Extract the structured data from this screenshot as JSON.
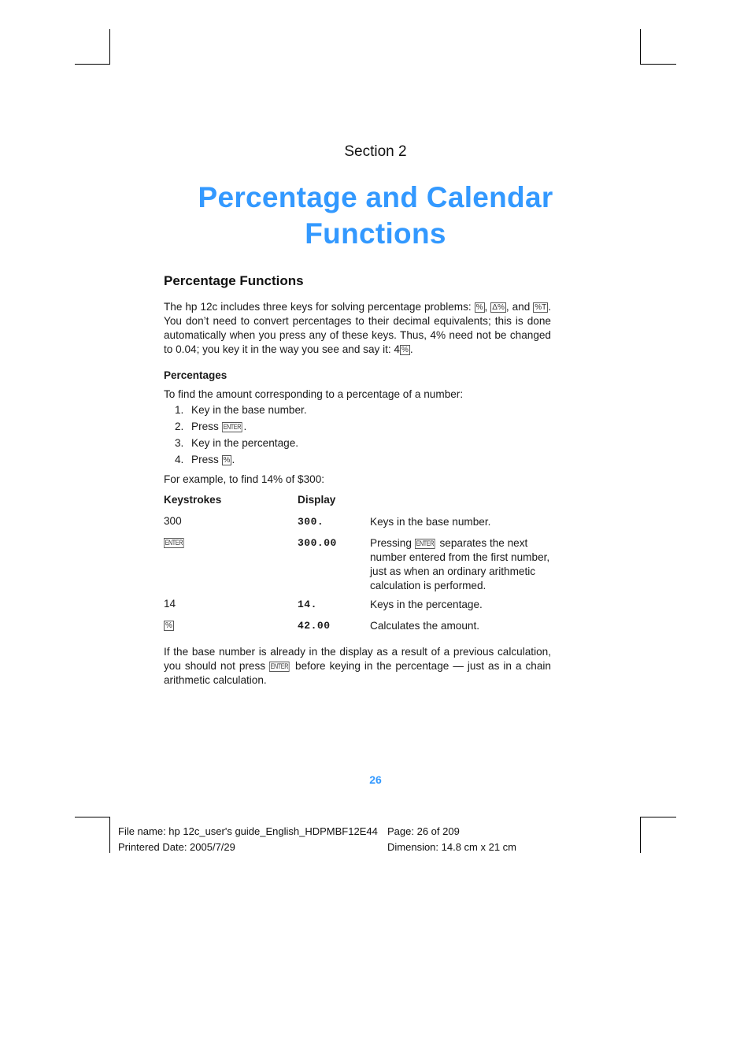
{
  "section_label": "Section 2",
  "title_line1": "Percentage and Calendar",
  "title_line2": "Functions",
  "heading": "Percentage Functions",
  "intro": {
    "part1": "The hp 12c includes three keys for solving percentage problems: ",
    "key1": "%",
    "sep1": ", ",
    "key2": "Δ%",
    "sep2": ", and ",
    "key3": "%T",
    "part2": ". You don’t need to convert percentages to their decimal equivalents; this is done automatically when you press any of these keys. Thus, 4% need not be changed to 0.04; you key it in the way you see and say it: 4",
    "key4": "%",
    "end": "."
  },
  "subheading": "Percentages",
  "steps_intro": "To find the amount corresponding to a percentage of a number:",
  "steps": [
    {
      "num": "1.",
      "text": "Key in the base number.",
      "key": "",
      "after": ""
    },
    {
      "num": "2.",
      "text": "Press ",
      "key": "ENTER",
      "after": "."
    },
    {
      "num": "3.",
      "text": "Key in the percentage.",
      "key": "",
      "after": ""
    },
    {
      "num": "4.",
      "text": "Press ",
      "key": "%",
      "after": "."
    }
  ],
  "example_intro": "For example, to find 14% of $300:",
  "table": {
    "headers": [
      "Keystrokes",
      "Display",
      ""
    ],
    "rows": [
      {
        "keystroke": "300",
        "is_key": false,
        "display": "300.",
        "desc_pre": "Keys in the base number.",
        "desc_key": "",
        "desc_post": ""
      },
      {
        "keystroke": "ENTER",
        "is_key": true,
        "display": "300.00",
        "desc_pre": "Pressing ",
        "desc_key": "ENTER",
        "desc_post": " separates the next number entered from the first number, just as when an ordinary arithmetic calculation is performed."
      },
      {
        "keystroke": "14",
        "is_key": false,
        "display": "14.",
        "desc_pre": "Keys in the percentage.",
        "desc_key": "",
        "desc_post": ""
      },
      {
        "keystroke": "%",
        "is_key": true,
        "display": "42.00",
        "desc_pre": "Calculates the amount.",
        "desc_key": "",
        "desc_post": ""
      }
    ]
  },
  "closing": {
    "pre": "If the base number is already in the display as a result of a previous calculation, you should not press ",
    "key": "ENTER",
    "post": " before keying in the percentage — just as in a chain arithmetic calculation."
  },
  "page_number": "26",
  "footer": {
    "file_name": "File name: hp 12c_user's guide_English_HDPMBF12E44",
    "printed_date": "Printered Date: 2005/7/29",
    "page": "Page: 26 of 209",
    "dimension": "Dimension: 14.8 cm x 21 cm"
  },
  "colors": {
    "accent": "#3399ff"
  }
}
